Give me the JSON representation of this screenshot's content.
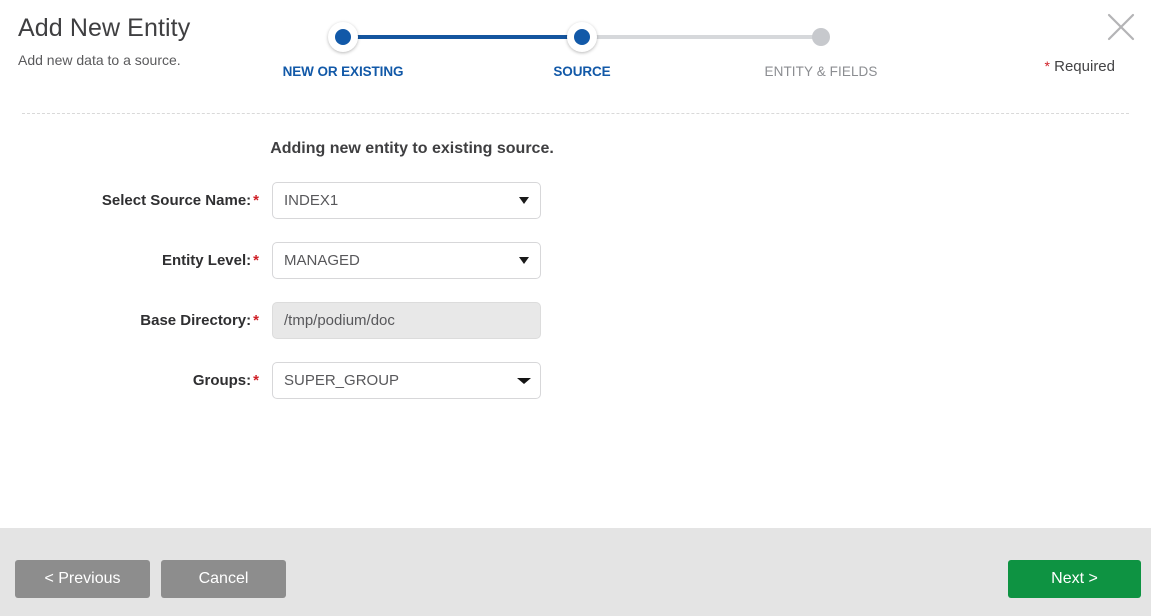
{
  "header": {
    "title": "Add New Entity",
    "subtitle": "Add new data to a source.",
    "required_note_asterisk": "*",
    "required_note_text": "Required",
    "close_icon": "close-icon"
  },
  "stepper": {
    "steps": [
      {
        "label": "NEW OR EXISTING",
        "state": "complete"
      },
      {
        "label": "SOURCE",
        "state": "active"
      },
      {
        "label": "ENTITY & FIELDS",
        "state": "inactive"
      }
    ],
    "active_color": "#1259a8",
    "track_active_color": "#14559f",
    "track_inactive_color": "#d6d8db",
    "inactive_color": "#c7c9cd"
  },
  "body": {
    "heading": "Adding new entity to existing source.",
    "fields": [
      {
        "label": "Select Source Name:",
        "required": "*",
        "value": "INDEX1",
        "type": "select",
        "disabled": false
      },
      {
        "label": "Entity Level:",
        "required": "*",
        "value": "MANAGED",
        "type": "select",
        "disabled": false
      },
      {
        "label": "Base Directory:",
        "required": "*",
        "value": "/tmp/podium/doc",
        "type": "text",
        "disabled": true
      },
      {
        "label": "Groups:",
        "required": "*",
        "value": "SUPER_GROUP",
        "type": "multiselect",
        "disabled": false
      }
    ]
  },
  "footer": {
    "previous_label": "< Previous",
    "cancel_label": "Cancel",
    "next_label": "Next >",
    "gray_color": "#8d8d8d",
    "green_color": "#0e9342",
    "background_color": "#e4e4e4"
  }
}
